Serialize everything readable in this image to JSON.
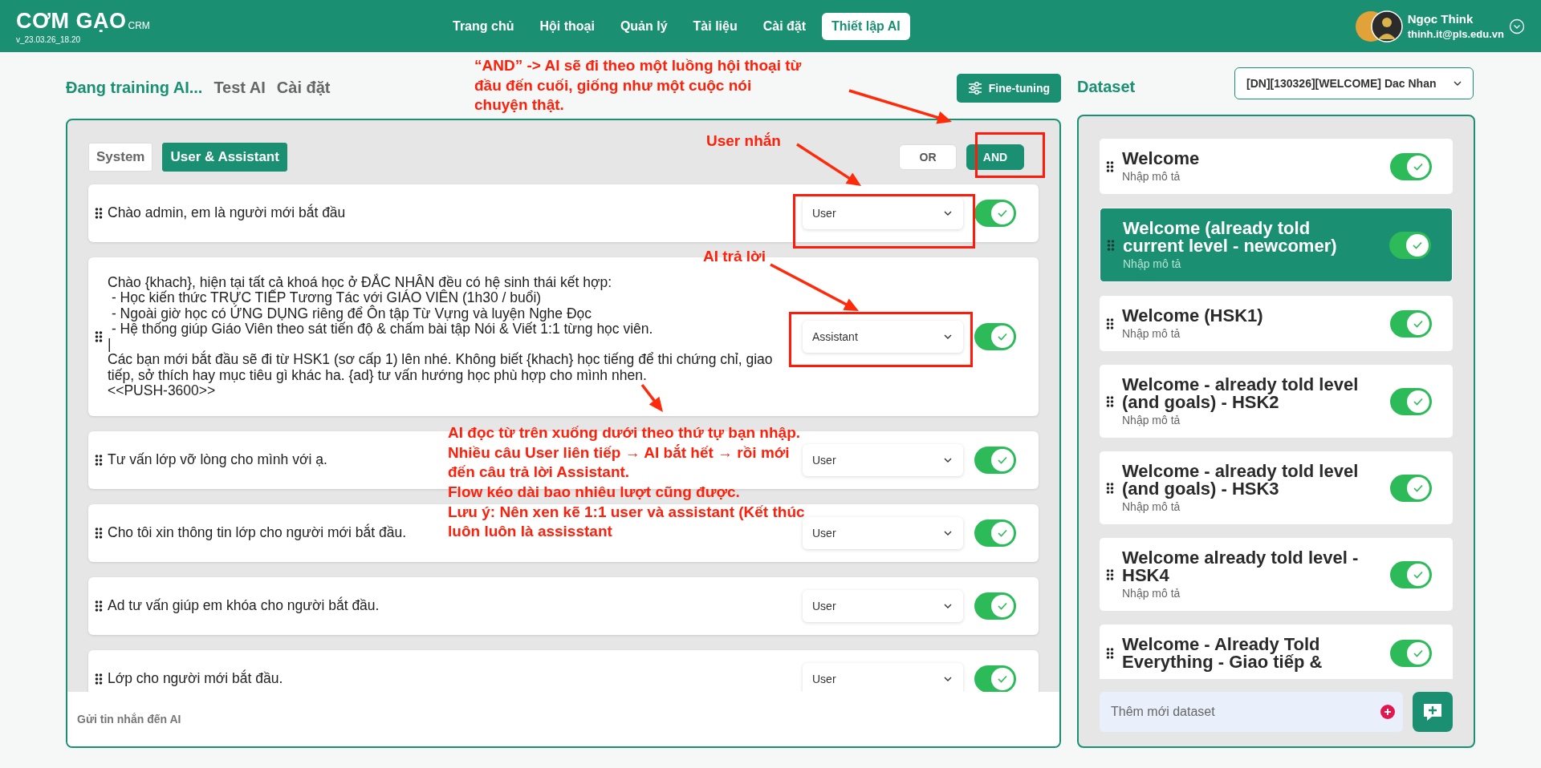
{
  "header": {
    "logo": "CƠM GẠO",
    "logo_suffix": "CRM",
    "version": "v_23.03.26_18.20",
    "nav": [
      {
        "label": "Trang chủ",
        "selected": false
      },
      {
        "label": "Hội thoại",
        "selected": false
      },
      {
        "label": "Quản lý",
        "selected": false
      },
      {
        "label": "Tài liệu",
        "selected": false
      },
      {
        "label": "Cài đặt",
        "selected": false
      },
      {
        "label": "Thiết lập AI",
        "selected": true
      }
    ],
    "user": {
      "name": "Ngọc Think",
      "email": "thinh.it@pls.edu.vn"
    }
  },
  "page_tabs": [
    {
      "label": "Đang training AI...",
      "selected": true
    },
    {
      "label": "Test AI",
      "selected": false
    },
    {
      "label": "Cài đặt",
      "selected": false
    }
  ],
  "fine_tuning_button": "Fine-tuning",
  "message_tabs": [
    {
      "label": "System",
      "selected": false
    },
    {
      "label": "User & Assistant",
      "selected": true
    }
  ],
  "mode": [
    {
      "label": "OR",
      "selected": false
    },
    {
      "label": "AND",
      "selected": true
    }
  ],
  "messages": [
    {
      "text": "Chào admin, em là người mới bắt đầu",
      "role": "User",
      "enabled": true
    },
    {
      "text": "Chào {khach}, hiện tại tất cả khoá học ở ĐẮC NHÂN đều có hệ sinh thái kết hợp:\n - Học kiến thức TRỰC TIẾP Tương Tác với GIÁO VIÊN (1h30 / buổi)\n - Ngoài giờ học có ỨNG DỤNG riêng để Ôn tập Từ Vựng và luyện Nghe Đọc\n - Hệ thống giúp Giáo Viên theo sát tiến độ & chấm bài tập Nói & Viết 1:1 từng học viên.\n|\nCác bạn mới bắt đầu sẽ đi từ HSK1 (sơ cấp 1) lên nhé. Không biết {khach} học tiếng để thi chứng chỉ, giao tiếp, sở thích hay mục tiêu gì khác ha. {ad} tư vấn hướng học phù hợp cho mình nhen.\n<<PUSH-3600>>",
      "role": "Assistant",
      "enabled": true
    },
    {
      "text": "Tư vấn lớp vỡ lòng cho mình với ạ.",
      "role": "User",
      "enabled": true
    },
    {
      "text": "Cho tôi xin thông tin lớp cho người mới bắt đầu.",
      "role": "User",
      "enabled": true
    },
    {
      "text": "Ad tư vấn giúp em khóa cho người bắt đầu.",
      "role": "User",
      "enabled": true
    },
    {
      "text": "Lớp cho người mới bắt đầu.",
      "role": "User",
      "enabled": true
    }
  ],
  "message_input": {
    "placeholder": "Gửi tin nhắn đến AI"
  },
  "dataset": {
    "title": "Dataset",
    "select_value": "[DN][130326][WELCOME] Dac Nhan",
    "items": [
      {
        "title": "Welcome",
        "description": "Nhập mô tả",
        "selected": false,
        "enabled": true
      },
      {
        "title": "Welcome (already told current level - newcomer)",
        "description": "Nhập mô tả",
        "selected": true,
        "enabled": true
      },
      {
        "title": "Welcome (HSK1)",
        "description": "Nhập mô tả",
        "selected": false,
        "enabled": true
      },
      {
        "title": "Welcome - already told level (and goals) - HSK2",
        "description": "Nhập mô tả",
        "selected": false,
        "enabled": true
      },
      {
        "title": "Welcome - already told level (and goals) - HSK3",
        "description": "Nhập mô tả",
        "selected": false,
        "enabled": true
      },
      {
        "title": "Welcome already told level - HSK4",
        "description": "Nhập mô tả",
        "selected": false,
        "enabled": true
      },
      {
        "title": "Welcome - Already Told Everything - Giao tiếp &",
        "selected": false,
        "enabled": true
      }
    ],
    "new_placeholder": "Thêm mới dataset"
  },
  "annotations": [
    {
      "kind": "note",
      "text": "“AND” -> AI sẽ đi theo một luồng hội thoại từ\nđầu đến cuối, giống như một cuộc nói\nchuyện thật."
    },
    {
      "kind": "note",
      "text": "User nhắn"
    },
    {
      "kind": "note",
      "text": "AI trả lời"
    },
    {
      "kind": "note",
      "text": "AI đọc từ trên xuống dưới theo thứ tự bạn nhập.\nNhiều câu User liên tiếp → AI bắt hết → rồi mới\nđến câu trả lời Assistant.\nFlow kéo dài bao nhiêu lượt cũng được.\nLưu ý: Nên xen kẽ 1:1 user và assistant (Kết thúc\nluôn luôn là assisstant"
    }
  ]
}
